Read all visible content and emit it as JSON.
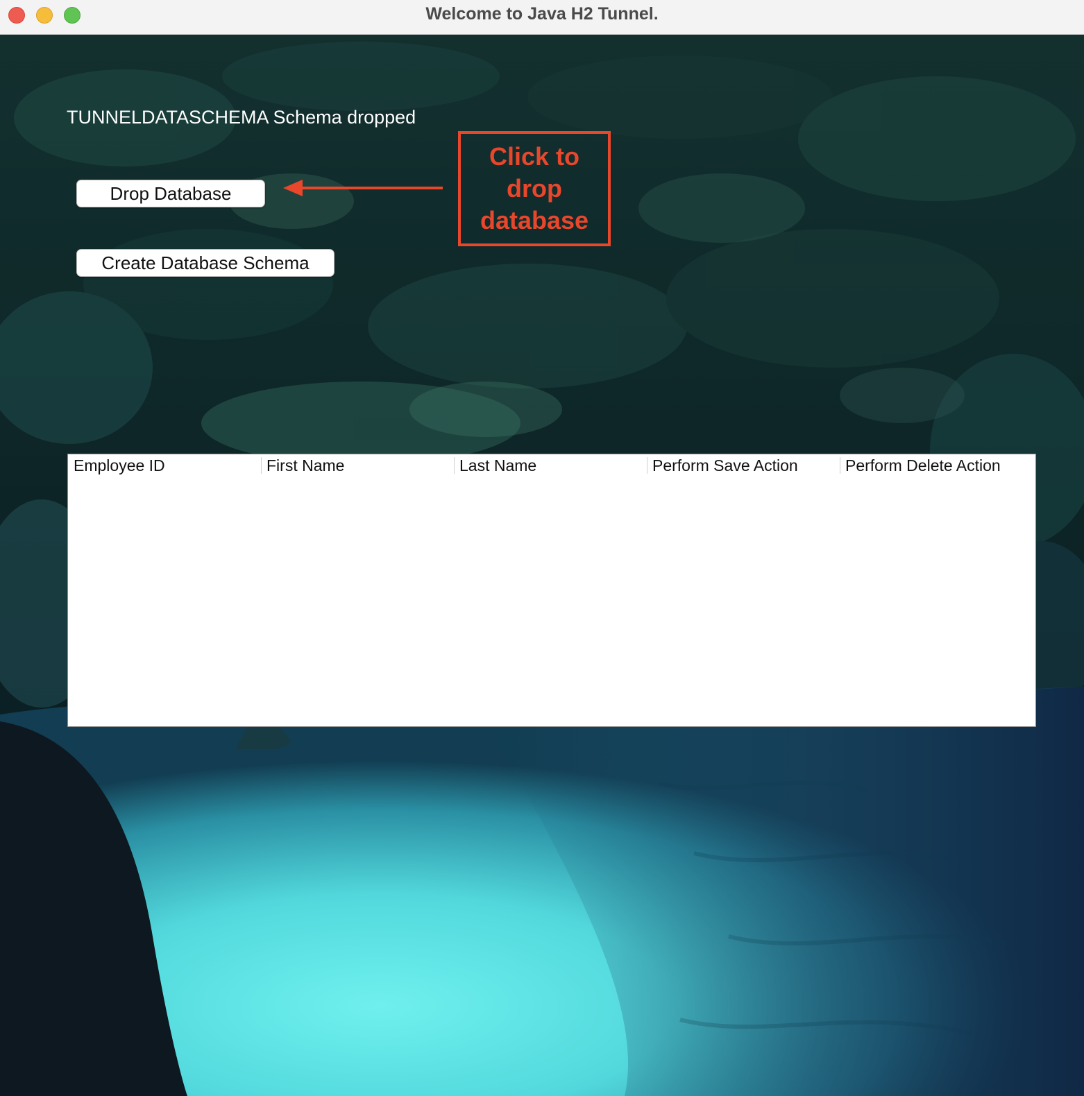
{
  "window": {
    "title": "Welcome to Java H2 Tunnel."
  },
  "status": {
    "message": "TUNNELDATASCHEMA Schema dropped"
  },
  "buttons": {
    "drop_database": "Drop Database",
    "create_schema": "Create Database Schema"
  },
  "annotation": {
    "line1": "Click to",
    "line2": "drop",
    "line3": "database",
    "color": "#e8472b"
  },
  "table": {
    "columns": [
      "Employee ID",
      "First Name",
      "Last Name",
      "Perform Save Action",
      "Perform Delete Action"
    ],
    "rows": []
  }
}
